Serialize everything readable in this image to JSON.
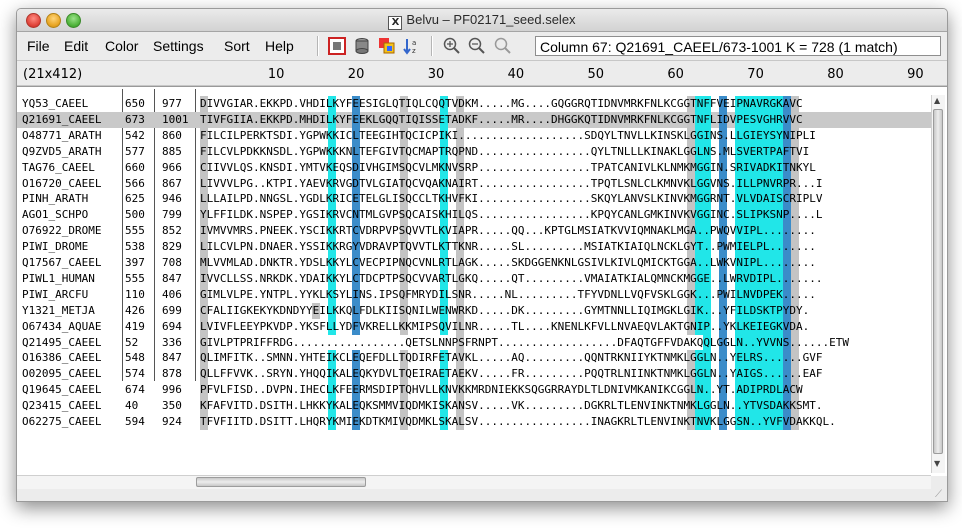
{
  "window": {
    "title": "PF02171_seed.selex",
    "title_prefix": "Belvu – "
  },
  "menu": {
    "items": [
      "File",
      "Edit",
      "Color",
      "Settings",
      "Sort",
      "Help"
    ]
  },
  "toolbar": {
    "icons": [
      "conservation-plot-icon",
      "tree-icon",
      "colors-icon",
      "sort-icon",
      "zoom-in-icon",
      "zoom-out-icon",
      "find-icon"
    ],
    "column_info": "Column 67: Q21691_CAEEL/673-1001  K = 728 (1 match)"
  },
  "ruler": {
    "size_label": "(21x412)",
    "ticks": [
      "10",
      "20",
      "30",
      "40",
      "50",
      "60",
      "70",
      "80",
      "90"
    ]
  },
  "colors": {
    "cyan": "#21e6e8",
    "steel": "#3b8cc9",
    "gray": "#c4c4c4",
    "selection": "#c9c9c9"
  },
  "alignment": {
    "selected_row": 1,
    "rows": [
      {
        "name": "YQ53_CAEEL",
        "start": "650",
        "end": "977",
        "seq": "DIVVGIAR.EKKPD.VHDILKYFEESIGLQTIQLCQQTVDKM.....MG....GQGGRQTIDNVMRKFNLKCGGTNFFVEIPNAVRGKAVC"
      },
      {
        "name": "Q21691_CAEEL",
        "start": "673",
        "end": "1001",
        "seq": "TIVFGIIA.EKKPD.MHDILKYFEEKLGQQTIQISSETADKF.....MR....DHGGKQTIDNVMRKFNLKCGGTNFLIDVPESVGHRVVC"
      },
      {
        "name": "O48771_ARATH",
        "start": "542",
        "end": "860",
        "seq": "FILCILPERKTSDI.YGPWKKICLTEEGIHTQCICPIKI...................SDQYLTNVLLKINSKLGGINS.LLGIEYSYNIPLI"
      },
      {
        "name": "Q9ZVD5_ARATH",
        "start": "577",
        "end": "885",
        "seq": "FILCVLPDKKNSDL.YGPWKKKNLTEFGIVTQCMAPTRQPND.................QYLTNLLLKINAKLGGLNS.MLSVERTPAFTVI"
      },
      {
        "name": "TAG76_CAEEL",
        "start": "660",
        "end": "966",
        "seq": "CIIVVLQS.KNSDI.YMTVKEQSDIVHGIMSQCVLMKNVSRP.................TPATCANIVLKLNMKMGGIN.SRIVADKITNKYL"
      },
      {
        "name": "O16720_CAEEL",
        "start": "566",
        "end": "867",
        "seq": "LIVVVLPG..KTPI.YAEVKRVGDTVLGIATQCVQAKNAIRT.................TPQTLSNLCLKMNVKLGGVNS.ILLPNVRPR...I"
      },
      {
        "name": "PINH_ARATH",
        "start": "625",
        "end": "946",
        "seq": "LLLAILPD.NNGSL.YGDLKRICETELGLISQCCLTKHVFKI.................SKQYLANVSLKINVKMGGRNT.VLVDAISCRIPLV"
      },
      {
        "name": "AGO1_SCHPO",
        "start": "500",
        "end": "799",
        "seq": "YLFFILDK.NSPEP.YGSIKRVCNTMLGVPSQCAISKHILQS.................KPQYCANLGMKINVKVGGINC.SLIPKSNP....L"
      },
      {
        "name": "O76922_DROME",
        "start": "555",
        "end": "852",
        "seq": "IVMVVMRS.PNEEK.YSCIKKRTCVDRPVPSQVVTLKVIAPR.....QQ...KPTGLMSIATKVVIQMNAKLMGA..PWQVVIPL........"
      },
      {
        "name": "PIWI_DROME",
        "start": "538",
        "end": "829",
        "seq": "LILCVLPN.DNAER.YSSIKKRGYVDRAVPTQVVTLKTTKNR.....SL.........MSIATKIAIQLNCKLGYT..PWMIELPL......."
      },
      {
        "name": "Q17567_CAEEL",
        "start": "397",
        "end": "708",
        "seq": "MLVVMLAD.DNKTR.YDSLKKYLCVECPIPNQCVNLRTLAGK.....SKDGGENKNLGSIVLKIVLQMICKTGGA..LWKVNIPL........"
      },
      {
        "name": "PIWL1_HUMAN",
        "start": "555",
        "end": "847",
        "seq": "IVVCLLSS.NRKDK.YDAIKKYLCTDCPTPSQCVVARTLGKQ.....QT.........VMAIATKIALQMNCKMGGE..LWRVDIPL......."
      },
      {
        "name": "PIWI_ARCFU",
        "start": "110",
        "end": "406",
        "seq": "GIMLVLPE.YNTPL.YYKLKSYLINS.IPSQFMRYDILSNR.....NL.........TFYVDNLLVQFVSKLGGK...PWILNVDPEK....."
      },
      {
        "name": "Y1321_METJA",
        "start": "426",
        "end": "699",
        "seq": "CFALIIGKEKYKDNDYYEILKKQLFDLKIISQNILWENWRKD.....DK.........GYMTNNLLIQIMGKLGIK...YFILDSKTPYDY."
      },
      {
        "name": "O67434_AQUAE",
        "start": "419",
        "end": "694",
        "seq": "LVIVFLEEYPKVDP.YKSFLLYDFVKRELLKKMIPSQVILNR.....TL....KNENLKFVLLNVAEQVLAKTGNIP..YKLKEIEGKVDA."
      },
      {
        "name": "Q21495_CAEEL",
        "start": "52",
        "end": "336",
        "seq": "GIVLPTPRIFFRDG.................QETSLNNPSFRNPT..................DFAQTGFFVDAKQQLGGLN..YVVNS......ETW"
      },
      {
        "name": "O16386_CAEEL",
        "start": "548",
        "end": "847",
        "seq": "QLIMFITK..SMNN.YHTEIKCLEQEFDLLTQDIRFETAVKL.....AQ.........QQNTRKNIIYKTNMKLGGLN..YELRS......GVF"
      },
      {
        "name": "O02095_CAEEL",
        "start": "574",
        "end": "878",
        "seq": "QLLFFVVK..SRYN.YHQQIKALEQKYDVLTQEIRAETAEKV.....FR.........PQQTRLNIINKTNMKLGGLN..YAIGS......EAF"
      },
      {
        "name": "Q19645_CAEEL",
        "start": "674",
        "end": "996",
        "seq": "PFVLFISD..DVPN.IHECLKFEERMSDIPTQHVLLKNVKKMRDNIEKKSQGGRRAYDLTLDNIVMKANIKCGGLN..YT.ADIPRDLACW"
      },
      {
        "name": "Q23415_CAEEL",
        "start": "40",
        "end": "350",
        "seq": "KFAFVITD.DSITH.LHKKYKALEQKSMMVIQDMKISKANSV.....VK.........DGKRLTLENVINKTNMKLGGLN..YTVSDAKKSMT."
      },
      {
        "name": "O62275_CAEEL",
        "start": "594",
        "end": "924",
        "seq": "TFVFIITD.DSITT.LHQRYKMIEKDTKMIVQDMKLSKALSV.................INAGKRLTLENVINKTNVKLGGSN..YVFVDAKKQL."
      }
    ]
  }
}
